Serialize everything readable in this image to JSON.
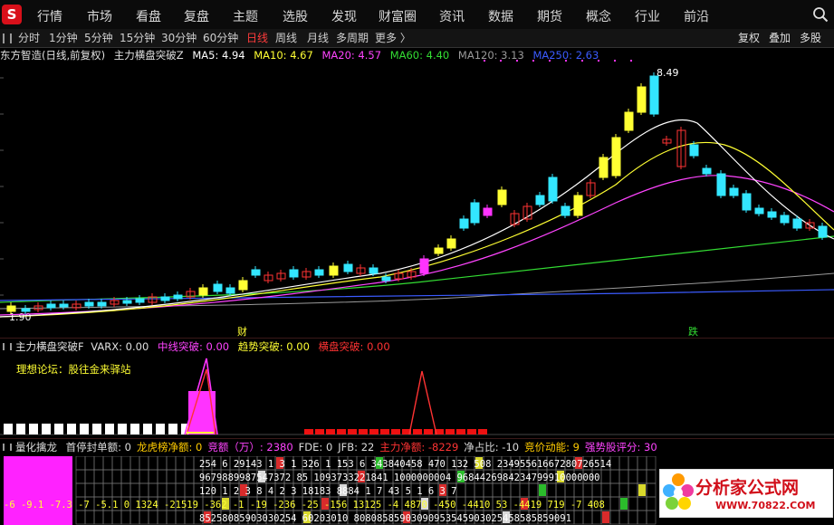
{
  "nav": {
    "logo": "S",
    "items": [
      "行情",
      "市场",
      "看盘",
      "复盘",
      "主题",
      "选股",
      "发现",
      "财富圈",
      "资讯",
      "数据",
      "期货",
      "概念",
      "行业",
      "前沿"
    ]
  },
  "periods": {
    "items": [
      "分时",
      "1分钟",
      "5分钟",
      "15分钟",
      "30分钟",
      "60分钟",
      "日线",
      "周线",
      "月线",
      "多周期",
      "更多 〉"
    ],
    "active": "日线"
  },
  "right_buttons": [
    "复权",
    "叠加",
    "多股"
  ],
  "main_legend": {
    "source": "东方智造(日线,前复权)",
    "indicator": "主力横盘突破Z",
    "ma5": {
      "label": "MA5: 4.94",
      "color": "#ffffff"
    },
    "ma10": {
      "label": "MA10: 4.67",
      "color": "#ffff33"
    },
    "ma20": {
      "label": "MA20: 4.57",
      "color": "#ff44ff"
    },
    "ma60": {
      "label": "MA60: 4.40",
      "color": "#33dd33"
    },
    "ma120": {
      "label": "MA120: 3.13",
      "color": "#9a9a9a"
    },
    "ma250": {
      "label": "MA250: 2.63",
      "color": "#3b5bff"
    }
  },
  "price_marks": {
    "high": "8.49",
    "low": "1.90"
  },
  "event_marks": [
    "财",
    "跌"
  ],
  "indicator": {
    "title": "主力横盘突破F",
    "varx": "VARX: 0.00",
    "mid": "中线突破: 0.00",
    "trend": "趋势突破: 0.00",
    "flat": "横盘突破: 0.00",
    "forum": "理想论坛：股往金来驿站"
  },
  "grid_legend": {
    "name": "量化擒龙",
    "items": [
      {
        "label": "首停封单额: 0",
        "color": "#dddddd"
      },
      {
        "label": "龙虎榜净额: 0",
        "color": "#ffcc00"
      },
      {
        "label": "竞额（万）: 2380",
        "color": "#ff44ff"
      },
      {
        "label": "FDE: 0",
        "color": "#dddddd"
      },
      {
        "label": "JFB: 22",
        "color": "#dddddd"
      },
      {
        "label": "主力净额: -8229",
        "color": "#ff3333"
      },
      {
        "label": "净占比: -10",
        "color": "#dddddd"
      },
      {
        "label": "竞价动能: 9",
        "color": "#ffcc00"
      },
      {
        "label": "强势股评分: 30",
        "color": "#ff44ff"
      }
    ]
  },
  "grid_rows": [
    "254  6  29143  1 3  1    326 1  153 6    343840458  470  132  508  23495561667280726514",
    "9679889987547372 85   1093733221841      1000000004  9684426984234799910000000",
    "120  1  2 3  8           4     2  3       18183   8884 1 7   43   5 1 6 3 7",
    "-6 -9.1 -7.3 -7 -5.1 0 1324 -21519 -362 -1 -19 -236 -25 -156 13125 -4 4870 -450 -4410 53 -4419 719 -7 408",
    "85258085903030254     60203010    80808585903090953545903025458585859091"
  ],
  "watermark": {
    "title": "分析家公式网",
    "url": "WWW.70822.COM"
  },
  "colors": {
    "up": "#ff3333",
    "down": "#33e6ff",
    "limit_up": "#ffff33",
    "magenta": "#ff33ff",
    "bg": "#000000"
  }
}
